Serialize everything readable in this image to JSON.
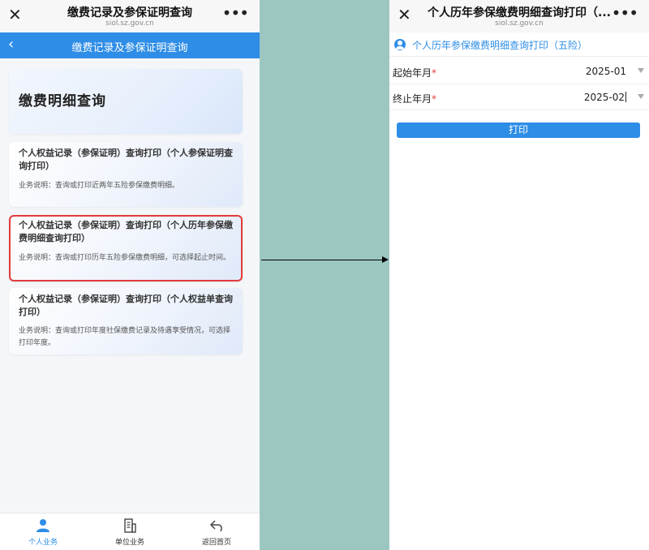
{
  "left_screen": {
    "wechat_bar": {
      "close_icon": "✕",
      "title": "缴费记录及参保证明查询",
      "domain": "siol.sz.gov.cn",
      "more_icon": "•••"
    },
    "header": {
      "back_icon": "‹",
      "title": "缴费记录及参保证明查询"
    },
    "hero": {
      "title": "缴费明细查询"
    },
    "cards": [
      {
        "title": "个人权益记录（参保证明）查询打印（个人参保证明查询打印）",
        "desc": "业务说明：查询或打印近两年五险参保缴费明细。"
      },
      {
        "title": "个人权益记录（参保证明）查询打印（个人历年参保缴费明细查询打印）",
        "desc": "业务说明：查询或打印历年五险参保缴费明细，可选择起止时间。",
        "highlighted": true
      },
      {
        "title": "个人权益记录（参保证明）查询打印（个人权益单查询打印）",
        "desc": "业务说明：查询或打印年度社保缴费记录及待遇享受情况，可选择打印年度。"
      }
    ],
    "tabbar": {
      "items": [
        {
          "label": "个人业务",
          "icon": "person-icon",
          "active": true
        },
        {
          "label": "单位业务",
          "icon": "building-doc-icon",
          "active": false
        },
        {
          "label": "返回首页",
          "icon": "return-arrow-icon",
          "active": false
        }
      ]
    }
  },
  "right_screen": {
    "wechat_bar": {
      "close_icon": "✕",
      "title": "个人历年参保缴费明细查询打印（...",
      "domain": "siol.sz.gov.cn",
      "more_icon": "•••"
    },
    "section": {
      "icon": "user-circle-icon",
      "title": "个人历年参保缴费明细查询打印（五险）"
    },
    "form": {
      "start": {
        "label": "起始年月",
        "required": "*",
        "value": "2025-01"
      },
      "end": {
        "label": "终止年月",
        "required": "*",
        "value": "2025-02"
      }
    },
    "print_button": "打印"
  },
  "colors": {
    "primary": "#2e8de6",
    "highlight_border": "#e23b3b",
    "background": "#9cc7c0"
  }
}
